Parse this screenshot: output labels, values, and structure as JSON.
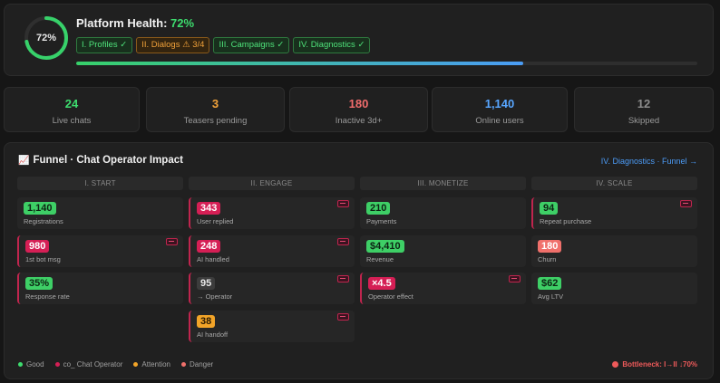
{
  "health": {
    "percent": "72%",
    "title_prefix": "Platform Health: ",
    "title_value": "72%",
    "progress_fraction": 0.72,
    "stages": [
      {
        "label": "I. Profiles ✓",
        "status": "good"
      },
      {
        "label": "II. Dialogs ⚠ 3/4",
        "status": "warn"
      },
      {
        "label": "III. Campaigns ✓",
        "status": "good"
      },
      {
        "label": "IV. Diagnostics ✓",
        "status": "good"
      }
    ]
  },
  "stats": [
    {
      "value": "24",
      "label": "Live chats",
      "color": "#3ddc6e"
    },
    {
      "value": "3",
      "label": "Teasers pending",
      "color": "#f2a33a"
    },
    {
      "value": "180",
      "label": "Inactive 3d+",
      "color": "#f06c6c"
    },
    {
      "value": "1,140",
      "label": "Online users",
      "color": "#58a6ff"
    },
    {
      "value": "12",
      "label": "Skipped",
      "color": "#8c8c8c"
    }
  ],
  "funnel": {
    "title": "Funnel · Chat Operator Impact",
    "link": "IV. Diagnostics · Funnel →",
    "columns": [
      {
        "header": "I. START",
        "cards": [
          {
            "value": "1,140",
            "label": "Registrations",
            "kind": "good",
            "flag": false
          },
          {
            "value": "980",
            "label": "1st bot msg",
            "kind": "op",
            "flag": true
          },
          {
            "value": "35%",
            "label": "Response rate",
            "kind": "good",
            "flag": true
          }
        ]
      },
      {
        "header": "II. ENGAGE",
        "cards": [
          {
            "value": "343",
            "label": "User replied",
            "kind": "op",
            "flag": true
          },
          {
            "value": "248",
            "label": "AI handled",
            "kind": "op",
            "flag": true
          },
          {
            "value": "95",
            "label": "→ Operator",
            "kind": "neutral",
            "flag": true
          },
          {
            "value": "38",
            "label": "AI handoff",
            "kind": "attn",
            "flag": true
          }
        ]
      },
      {
        "header": "III. MONETIZE",
        "cards": [
          {
            "value": "210",
            "label": "Payments",
            "kind": "good",
            "flag": false
          },
          {
            "value": "$4,410",
            "label": "Revenue",
            "kind": "good",
            "flag": false
          },
          {
            "value": "×4.5",
            "label": "Operator effect",
            "kind": "op",
            "flag": true
          }
        ]
      },
      {
        "header": "IV. SCALE",
        "cards": [
          {
            "value": "94",
            "label": "Repeat purchase",
            "kind": "good",
            "flag": true
          },
          {
            "value": "180",
            "label": "Churn",
            "kind": "danger",
            "flag": false
          },
          {
            "value": "$62",
            "label": "Avg LTV",
            "kind": "good",
            "flag": false
          }
        ]
      }
    ],
    "legend": [
      {
        "label": "Good",
        "color": "#3ddc6e"
      },
      {
        "label": "co_ Chat Operator",
        "color": "#d51f55"
      },
      {
        "label": "Attention",
        "color": "#f2a428"
      },
      {
        "label": "Danger",
        "color": "#f0706b"
      }
    ],
    "bottleneck": "Bottleneck: I→II ↓70%"
  }
}
